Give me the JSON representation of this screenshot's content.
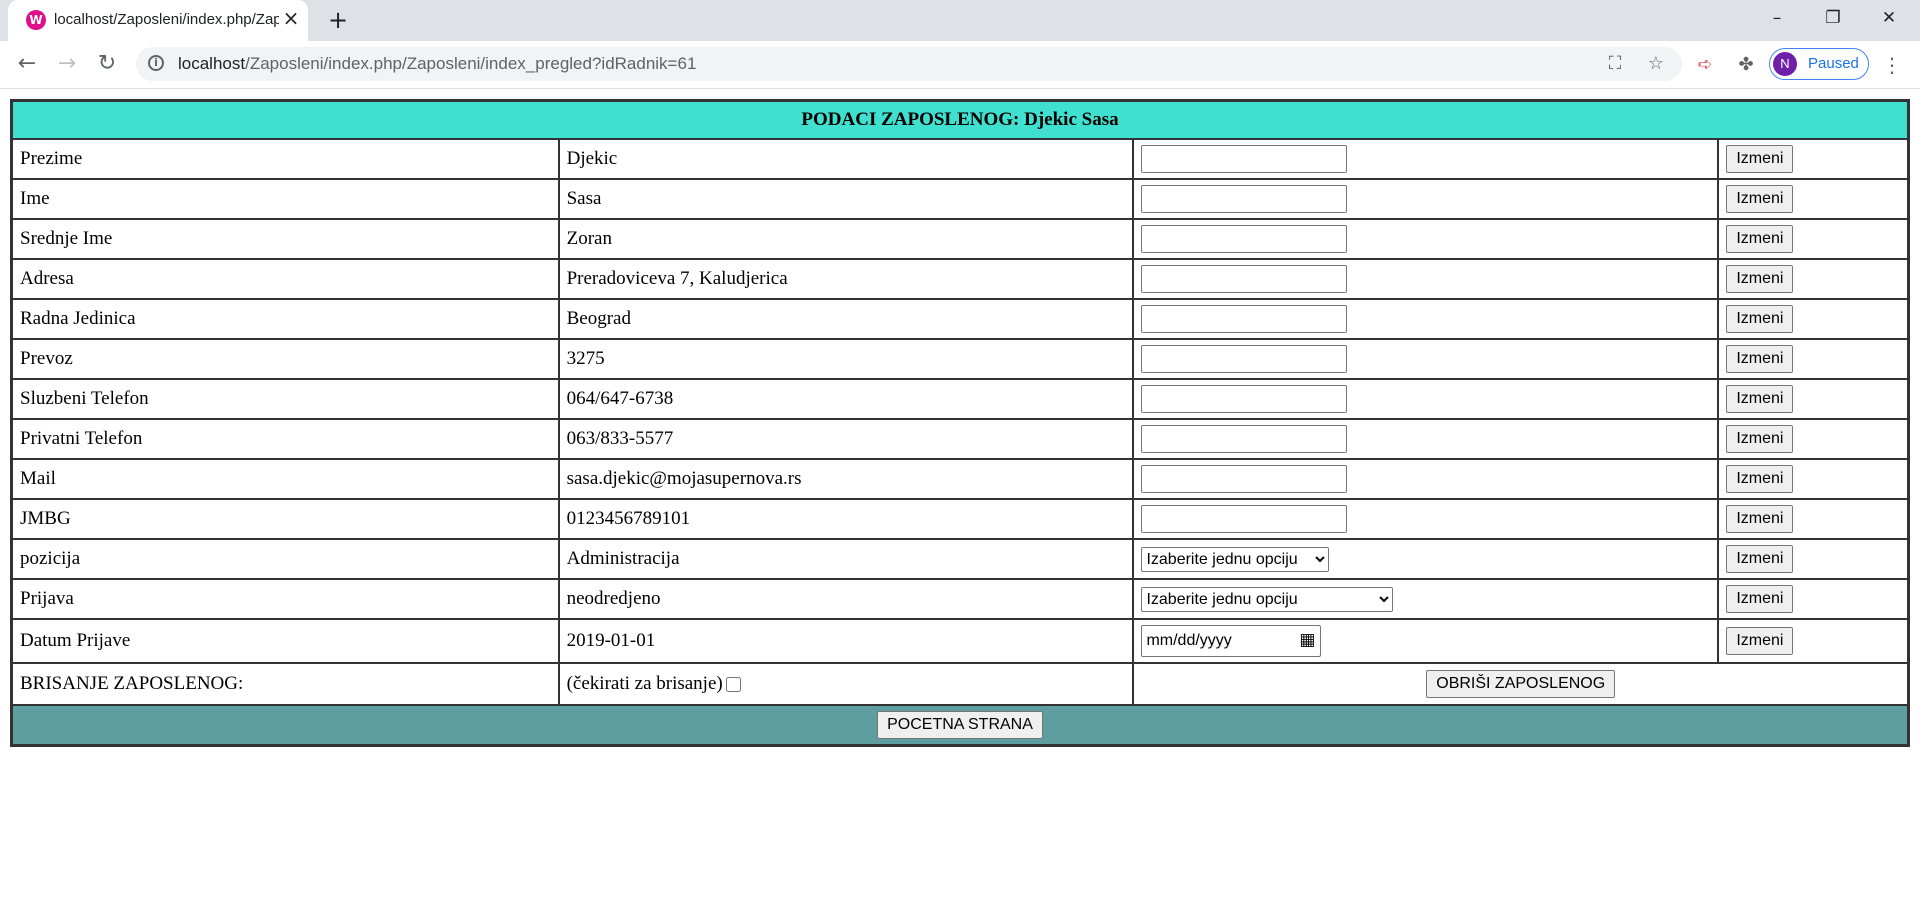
{
  "browser": {
    "tab_title": "localhost/Zaposleni/index.php/Zaposleni/index_pregled?idRadnik=61",
    "url_host": "localhost",
    "url_path": "/Zaposleni/index.php/Zaposleni/index_pregled?idRadnik=61",
    "profile_initial": "N",
    "profile_status": "Paused"
  },
  "employee": {
    "header": "PODACI ZAPOSLENOG: Djekic Sasa",
    "button_label": "Izmeni",
    "fields": [
      {
        "label": "Prezime",
        "value": "Djekic"
      },
      {
        "label": "Ime",
        "value": "Sasa"
      },
      {
        "label": "Srednje Ime",
        "value": "Zoran"
      },
      {
        "label": "Adresa",
        "value": "Preradoviceva 7, Kaludjerica"
      },
      {
        "label": "Radna Jedinica",
        "value": "Beograd"
      },
      {
        "label": "Prevoz",
        "value": "3275"
      },
      {
        "label": "Sluzbeni Telefon",
        "value": "064/647-6738"
      },
      {
        "label": "Privatni Telefon",
        "value": "063/833-5577"
      },
      {
        "label": "Mail",
        "value": "sasa.djekic@mojasupernova.rs"
      },
      {
        "label": "JMBG",
        "value": "0123456789101"
      },
      {
        "label": "pozicija",
        "value": "Administracija",
        "select": "Izaberite jednu opciju"
      },
      {
        "label": "Prijava",
        "value": "neodredjeno",
        "select": "Izaberite jednu opciju"
      },
      {
        "label": "Datum Prijave",
        "value": "2019-01-01",
        "date_placeholder": "mm/dd/yyyy"
      }
    ],
    "delete_label": "BRISANJE ZAPOSLENOG:",
    "delete_check_text": "(čekirati za brisanje)",
    "delete_button": "OBRIŠI ZAPOSLENOG",
    "home_button": "POCETNA STRANA"
  },
  "colors": {
    "header_bg": "#40e0d0",
    "footer_bg": "#5f9ea0"
  }
}
